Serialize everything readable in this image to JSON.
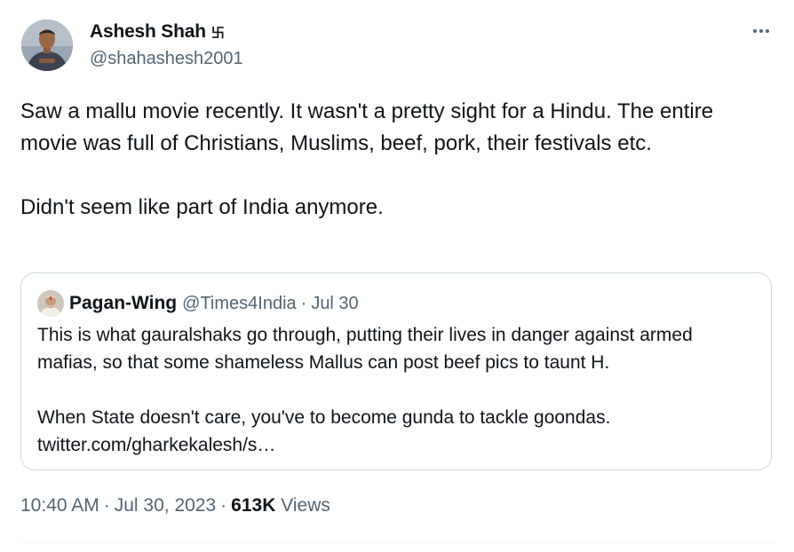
{
  "author": {
    "display_name": "Ashesh Shah",
    "name_symbol": "卐",
    "handle": "@shahashesh2001"
  },
  "tweet": {
    "paragraphs": [
      "Saw a mallu movie recently. It wasn't a pretty sight for a Hindu. The entire movie was full of Christians, Muslims, beef, pork, their festivals etc.",
      "Didn't seem like part of India anymore."
    ]
  },
  "quoted_tweet": {
    "display_name": "Pagan-Wing",
    "handle": "@Times4India",
    "separator": "·",
    "date": "Jul 30",
    "paragraphs": [
      "This is what gauralshaks go through, putting their lives in danger against armed mafias, so that some shameless Mallus can post beef pics to taunt H.",
      "When State doesn't care, you've to become gunda to tackle goondas.",
      "twitter.com/gharkekalesh/s…"
    ]
  },
  "meta": {
    "time": "10:40 AM",
    "separator": "·",
    "date": "Jul 30, 2023",
    "views_count": "613K",
    "views_label": "Views"
  },
  "icons": {
    "more": "more-horizontal-icon"
  },
  "colors": {
    "text_primary": "#0f1419",
    "text_secondary": "#536471",
    "border": "#cfd9de",
    "divider": "#eff3f4"
  }
}
